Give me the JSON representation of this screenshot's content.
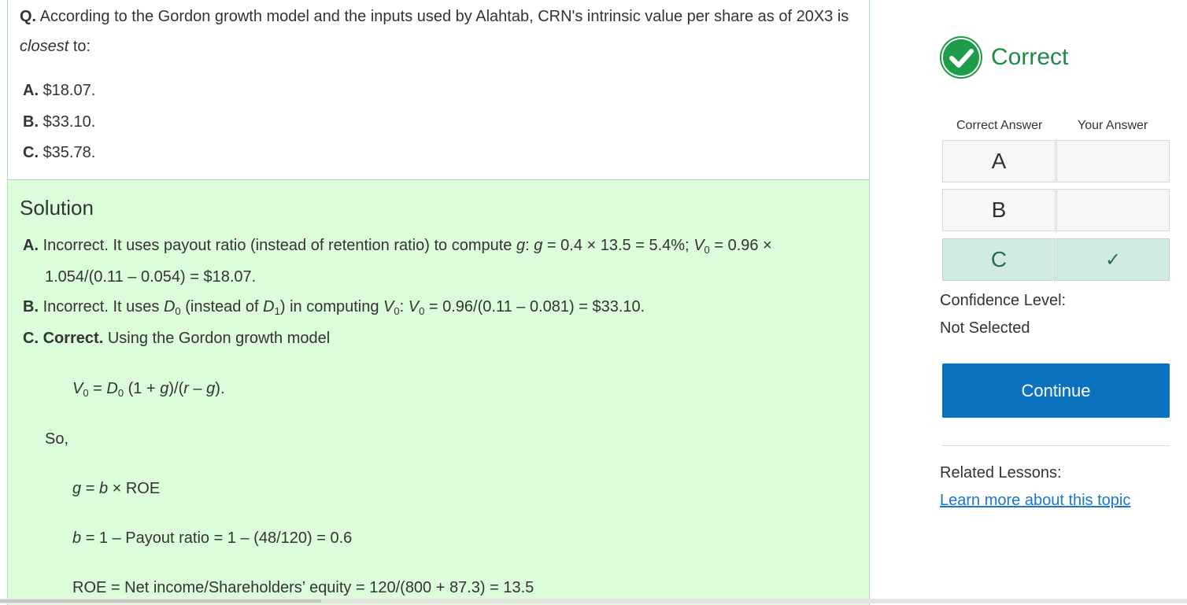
{
  "question": {
    "prefix": "Q.",
    "text_a": "According to the Gordon growth model and the inputs used by Alahtab, CRN's intrinsic value per share as of 20X3 is",
    "text_em": "closest",
    "text_b": "to:",
    "options": [
      {
        "letter": "A.",
        "text": "$18.07."
      },
      {
        "letter": "B.",
        "text": "$33.10."
      },
      {
        "letter": "C.",
        "text": "$35.78."
      }
    ]
  },
  "solution": {
    "title": "Solution",
    "a_letter": "A.",
    "a_text1": "Incorrect. It uses payout ratio (instead of retention ratio) to compute",
    "a_g": "g",
    "a_text2": ":",
    "a_g2": "g",
    "a_text3": "= 0.4 × 13.5 = 5.4%;",
    "a_v": "V",
    "a_sub0": "0",
    "a_text4": "= 0.96 ×",
    "a_line2": "1.054/(0.11 – 0.054) = $18.07.",
    "b_letter": "B.",
    "b_text1": "Incorrect. It uses",
    "b_d": "D",
    "b_sub0": "0",
    "b_text2": "(instead of",
    "b_d1": "D",
    "b_sub1": "1",
    "b_text3": ") in computing",
    "b_v": "V",
    "b_sub0b": "0",
    "b_text4": ":",
    "b_v2": "V",
    "b_sub0c": "0",
    "b_text5": "= 0.96/(0.11 – 0.081) = $33.10.",
    "c_letter": "C.",
    "c_bold": "Correct.",
    "c_text": "Using the Gordon growth model",
    "f1_v": "V",
    "f1_sub": "0",
    "f1_eq": "=",
    "f1_d": "D",
    "f1_dsub": "0",
    "f1_rest1": "(1 +",
    "f1_g": "g",
    "f1_rest2": ")/(",
    "f1_r": "r",
    "f1_rest3": "–",
    "f1_g2": "g",
    "f1_rest4": ").",
    "so": "So,",
    "f2_g": "g",
    "f2_eq": "=",
    "f2_b": "b",
    "f2_rest": "× ROE",
    "f3_b": "b",
    "f3_rest": "= 1 – Payout ratio = 1 – (48/120) = 0.6",
    "f4": "ROE = Net income/Shareholders’ equity = 120/(800 + 87.3) = 13.5"
  },
  "result": {
    "status": "Correct",
    "status_color": "#1e9c4a",
    "icon": "check-circle-icon",
    "col_correct": "Correct Answer",
    "col_yours": "Your Answer",
    "rows": [
      {
        "letter": "A",
        "your_mark": ""
      },
      {
        "letter": "B",
        "your_mark": ""
      },
      {
        "letter": "C",
        "your_mark": "✓"
      }
    ],
    "confidence_label": "Confidence Level:",
    "confidence_value": "Not Selected",
    "continue_label": "Continue",
    "continue_color": "#0b72c0",
    "related_label": "Related Lessons:",
    "related_link": "Learn more about this topic"
  }
}
